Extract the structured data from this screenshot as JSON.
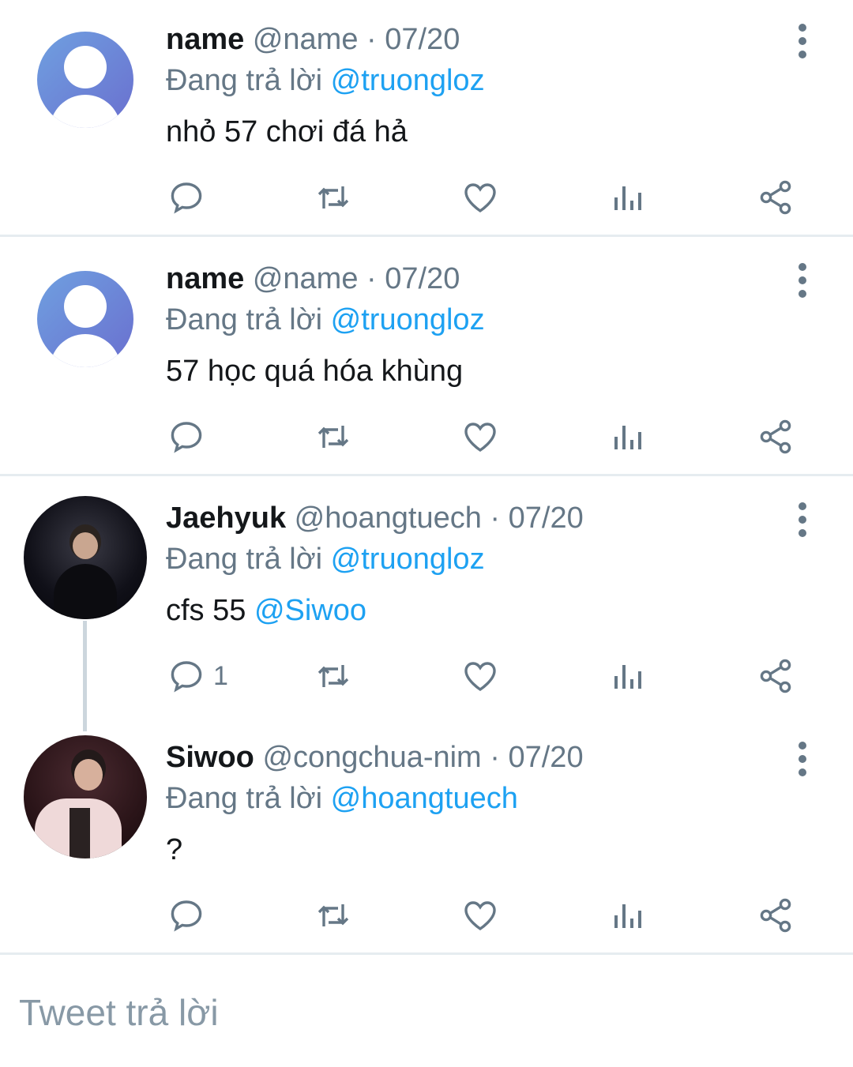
{
  "tweets": [
    {
      "name": "name",
      "handle_date": "@name · 07/20",
      "reply_prefix": "Đang trả lời ",
      "reply_to": "@truongloz",
      "text": "nhỏ 57 chơi đá hả",
      "reply_count": ""
    },
    {
      "name": "name",
      "handle_date": "@name · 07/20",
      "reply_prefix": "Đang trả lời ",
      "reply_to": "@truongloz",
      "text": "57 học quá hóa khùng",
      "reply_count": ""
    },
    {
      "name": "Jaehyuk",
      "handle_date": "@hoangtuech · 07/20",
      "reply_prefix": "Đang trả lời ",
      "reply_to": "@truongloz",
      "text": "cfs 55 ",
      "text_mention": "@Siwoo",
      "reply_count": "1"
    },
    {
      "name": "Siwoo",
      "handle_date": "@congchua-nim · 07/20",
      "reply_prefix": "Đang trả lời ",
      "reply_to": "@hoangtuech",
      "text": "?",
      "reply_count": ""
    }
  ],
  "compose": {
    "placeholder": "Tweet trả lời"
  },
  "icons": {
    "reply": "reply-icon",
    "retweet": "retweet-icon",
    "like": "heart-icon",
    "analytics": "analytics-icon",
    "share": "share-icon",
    "more": "more-vertical-icon"
  },
  "colors": {
    "mention": "#1da1f2",
    "secondary": "#657786",
    "icon": "#657786"
  }
}
